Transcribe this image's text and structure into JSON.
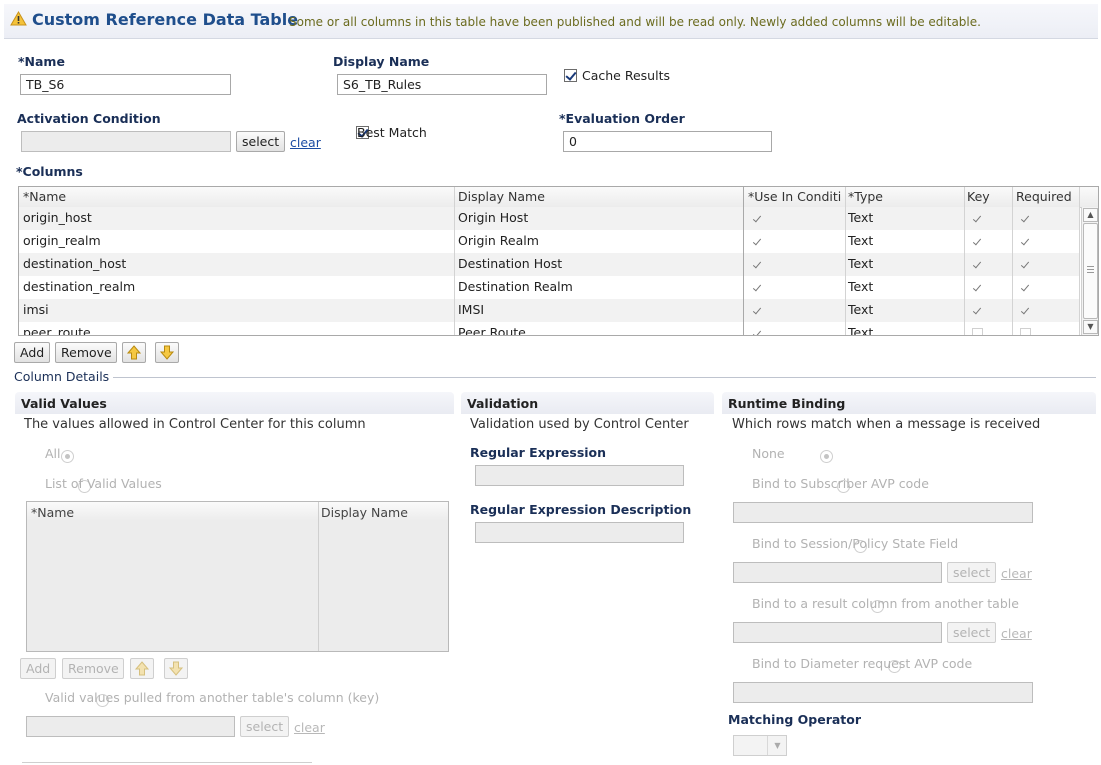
{
  "header": {
    "title": "Custom Reference Data Table",
    "notice": "Some or all columns in this table have been published and will be read only.  Newly added columns will be editable."
  },
  "form": {
    "name_label": "*Name",
    "name_value": "TB_S6",
    "display_name_label": "Display Name",
    "display_name_value": "S6_TB_Rules",
    "cache_results_label": "Cache Results",
    "cache_results_checked": true,
    "activation_condition_label": "Activation Condition",
    "activation_condition_value": "",
    "select_label": "select",
    "clear_label": "clear",
    "best_match_label": "Best Match",
    "best_match_checked": true,
    "evaluation_order_label": "*Evaluation Order",
    "evaluation_order_value": "0"
  },
  "columns": {
    "label": "*Columns",
    "headers": [
      "*Name",
      "Display Name",
      "*Use In Conditi",
      "*Type",
      "Key",
      "Required"
    ],
    "rows": [
      {
        "name": "origin_host",
        "display": "Origin Host",
        "use": true,
        "type": "Text",
        "key": true,
        "required": true
      },
      {
        "name": "origin_realm",
        "display": "Origin Realm",
        "use": true,
        "type": "Text",
        "key": true,
        "required": true
      },
      {
        "name": "destination_host",
        "display": "Destination Host",
        "use": true,
        "type": "Text",
        "key": true,
        "required": true
      },
      {
        "name": "destination_realm",
        "display": "Destination Realm",
        "use": true,
        "type": "Text",
        "key": true,
        "required": true
      },
      {
        "name": "imsi",
        "display": "IMSI",
        "use": true,
        "type": "Text",
        "key": true,
        "required": true
      },
      {
        "name": "peer_route",
        "display": "Peer Route",
        "use": true,
        "type": "Text",
        "key": false,
        "required": false
      }
    ],
    "add_label": "Add",
    "remove_label": "Remove"
  },
  "column_details": {
    "legend": "Column Details",
    "valid_values": {
      "title": "Valid Values",
      "description": "The values allowed in Control Center for this column",
      "radio_all": "All",
      "radio_list": "List of Valid Values",
      "grid_headers": [
        "*Name",
        "Display Name"
      ],
      "add_label": "Add",
      "remove_label": "Remove",
      "radio_pulled": "Valid values pulled from another table's column (key)",
      "select_label": "select",
      "clear_label": "clear"
    },
    "validation": {
      "title": "Validation",
      "description": "Validation used by Control Center",
      "regex_label": "Regular Expression",
      "regex_desc_label": "Regular Expression Description"
    },
    "runtime_binding": {
      "title": "Runtime Binding",
      "description": "Which rows match when a message is received",
      "radio_none": "None",
      "radio_subscriber": "Bind to Subscriber AVP code",
      "radio_session": "Bind to Session/Policy State Field",
      "radio_result": "Bind to a result column from another table",
      "radio_diameter": "Bind to Diameter request AVP code",
      "select_label": "select",
      "clear_label": "clear",
      "matching_operator_label": "Matching Operator"
    }
  },
  "colors": {
    "title": "#1f4e8c",
    "notice": "#6b6b1f",
    "label": "#1a2f57",
    "link": "#1c4ca3"
  }
}
